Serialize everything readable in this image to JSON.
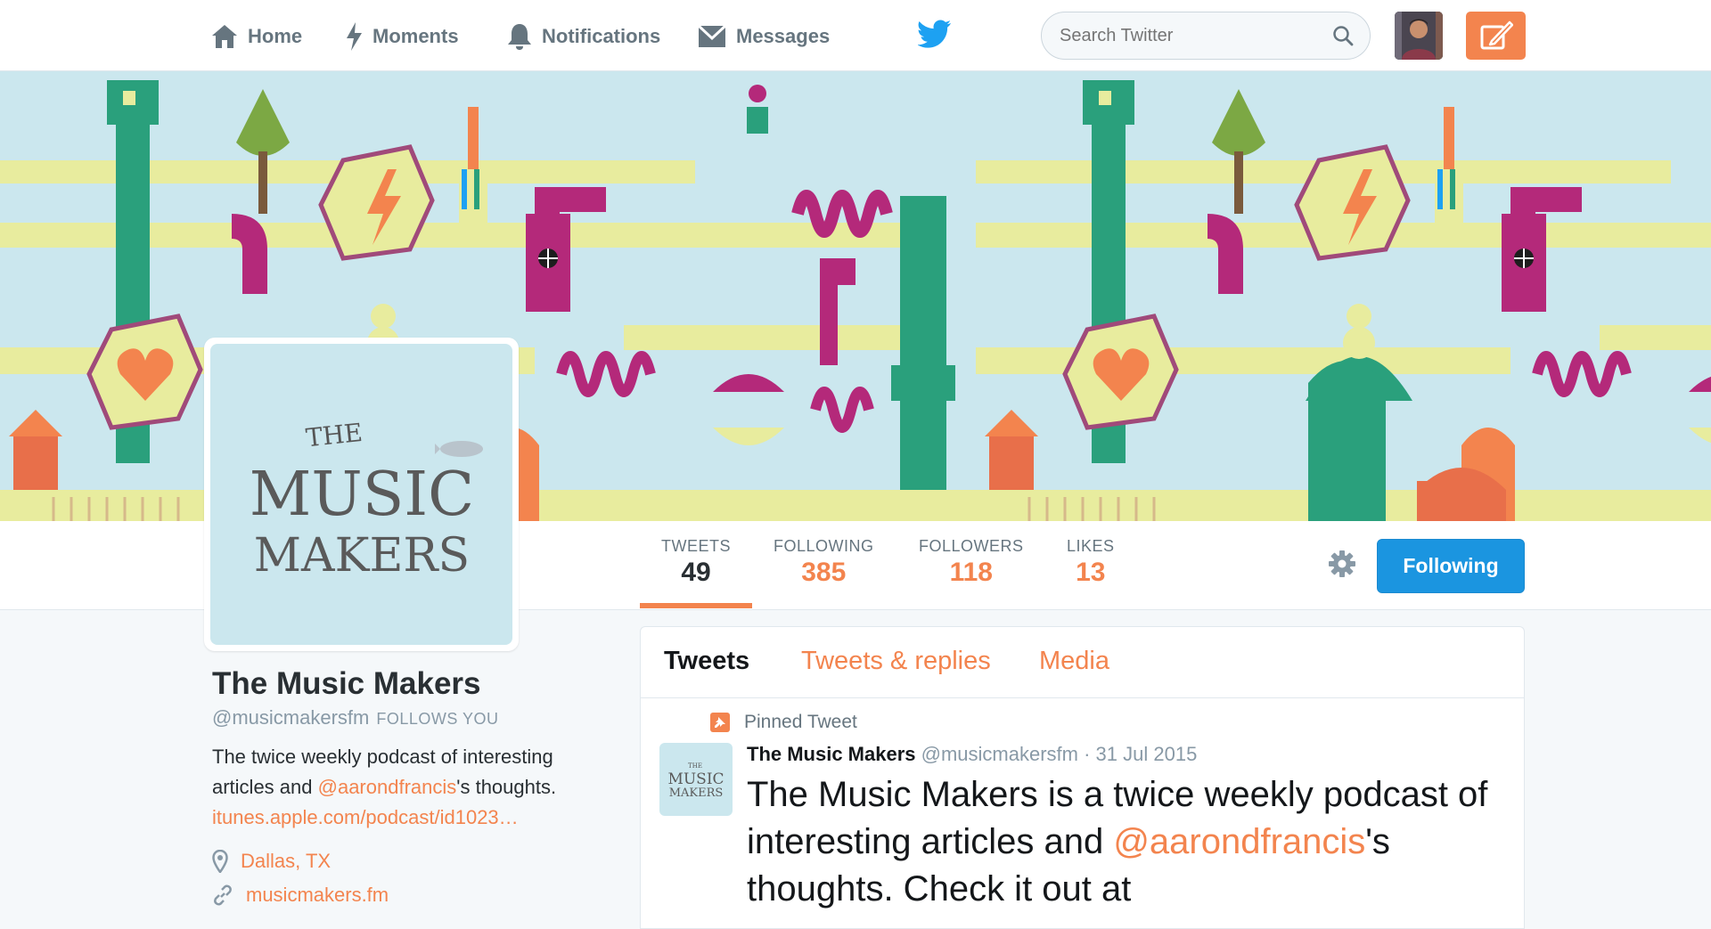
{
  "nav": {
    "home": "Home",
    "moments": "Moments",
    "notifications": "Notifications",
    "messages": "Messages",
    "search_placeholder": "Search Twitter",
    "icons": [
      "home-icon",
      "moments-icon",
      "notifications-icon",
      "messages-icon",
      "twitter-bird-icon",
      "search-icon",
      "avatar",
      "compose-tweet-icon"
    ]
  },
  "banner": {
    "logo_the": "THE",
    "logo_music": "MUSIC",
    "logo_makers": "MAKERS"
  },
  "stats": [
    {
      "label": "TWEETS",
      "value": "49"
    },
    {
      "label": "FOLLOWING",
      "value": "385"
    },
    {
      "label": "FOLLOWERS",
      "value": "118"
    },
    {
      "label": "LIKES",
      "value": "13"
    }
  ],
  "actions": {
    "following_button": "Following"
  },
  "profile": {
    "name": "The Music Makers",
    "handle": "@musicmakersfm",
    "follows_you": "FOLLOWS YOU",
    "bio_part1": "The twice weekly podcast of interesting articles and ",
    "bio_mention": "@aarondfrancis",
    "bio_part2": "'s thoughts.",
    "bio_link": "itunes.apple.com/podcast/id1023…",
    "location": "Dallas, TX",
    "website": "musicmakers.fm"
  },
  "timeline": {
    "tabs": [
      "Tweets",
      "Tweets & replies",
      "Media"
    ],
    "pinned_label": "Pinned Tweet",
    "tweet": {
      "author": "The Music Makers",
      "handle": "@musicmakersfm",
      "date": "· 31 Jul 2015",
      "avatar_the": "THE",
      "avatar_music": "MUSIC",
      "avatar_makers": "MAKERS",
      "text_part1": "The Music Makers is a twice weekly podcast of interesting articles and ",
      "text_mention": "@aarondfrancis",
      "text_part2": "'s thoughts. Check it out at"
    }
  },
  "colors": {
    "accent": "#f3844e",
    "button_blue": "#1b95e0",
    "twitter_blue": "#1da1f2",
    "banner_bg": "#cbe7ee"
  }
}
